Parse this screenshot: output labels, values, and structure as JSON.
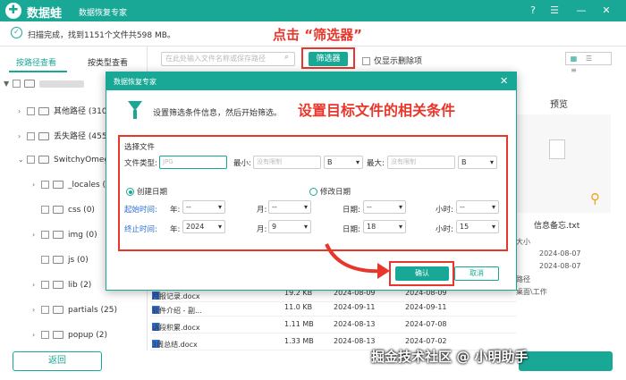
{
  "app": {
    "brand": "数据蛙",
    "subname": "数据恢复专家"
  },
  "status": {
    "scan_text": "扫描完成，找到1151个文件共598 MB。"
  },
  "annotations": {
    "filter": "点击 “筛选器”",
    "conditions": "设置目标文件的相关条件"
  },
  "tabs": {
    "by_path": "按路径查看",
    "by_type": "按类型查看"
  },
  "toolbar": {
    "search_placeholder": "在此处输入文件名称或保存路径",
    "filter_button": "筛选器",
    "show_deleted": "仅显示删除项"
  },
  "tree": [
    {
      "label": "其他路径 (310)"
    },
    {
      "label": "丢失路径 (455)"
    },
    {
      "label": "SwitchyOmega"
    },
    {
      "label": "_locales (6)"
    },
    {
      "label": "css (0)"
    },
    {
      "label": "img (0)"
    },
    {
      "label": "js (0)"
    },
    {
      "label": "lib (2)"
    },
    {
      "label": "partials (25)"
    },
    {
      "label": "popup (2)"
    }
  ],
  "files": [
    {
      "name": "月报记录.docx",
      "size": "19.2 KB",
      "date1": "2024-08-09",
      "date2": "2024-08-09"
    },
    {
      "name": "软件介绍 - 副...",
      "size": "11.0 KB",
      "date1": "2024-09-11",
      "date2": "2024-09-11"
    },
    {
      "name": "语段积累.docx",
      "size": "1.11 MB",
      "date1": "2024-08-13",
      "date2": "2024-07-08"
    },
    {
      "name": "3周总结.docx",
      "size": "1.33 MB",
      "date1": "2024-08-13",
      "date2": "2024-07-02"
    }
  ],
  "preview": {
    "title": "预览",
    "filename": "信息备忘.txt",
    "fields": [
      "大小",
      "2024-08-07",
      "2024-08-07",
      "路径",
      "桌面\\工作"
    ]
  },
  "dialog": {
    "title": "数据恢复专家",
    "description": "设置筛选条件信息，然后开始筛选。",
    "section": "选择文件",
    "file_type_label": "文件类型:",
    "file_type_placeholder": "JPG",
    "min_label": "最小:",
    "min_placeholder": "没有限制",
    "min_unit": "B",
    "max_label": "最大:",
    "max_placeholder": "没有限制",
    "max_unit": "B",
    "created_date": "创建日期",
    "modified_date": "修改日期",
    "start_label": "起始时间:",
    "end_label": "终止时间:",
    "year_label": "年:",
    "month_label": "月:",
    "day_label": "日期:",
    "hour_label": "小时:",
    "start": {
      "year": "--",
      "month": "--",
      "day": "--",
      "hour": "--"
    },
    "end": {
      "year": "2024",
      "month": "9",
      "day": "18",
      "hour": "15"
    },
    "ok": "确认",
    "cancel": "取消"
  },
  "bottom": {
    "back": "返回"
  },
  "watermark": "掘金技术社区 @ 小明助手"
}
